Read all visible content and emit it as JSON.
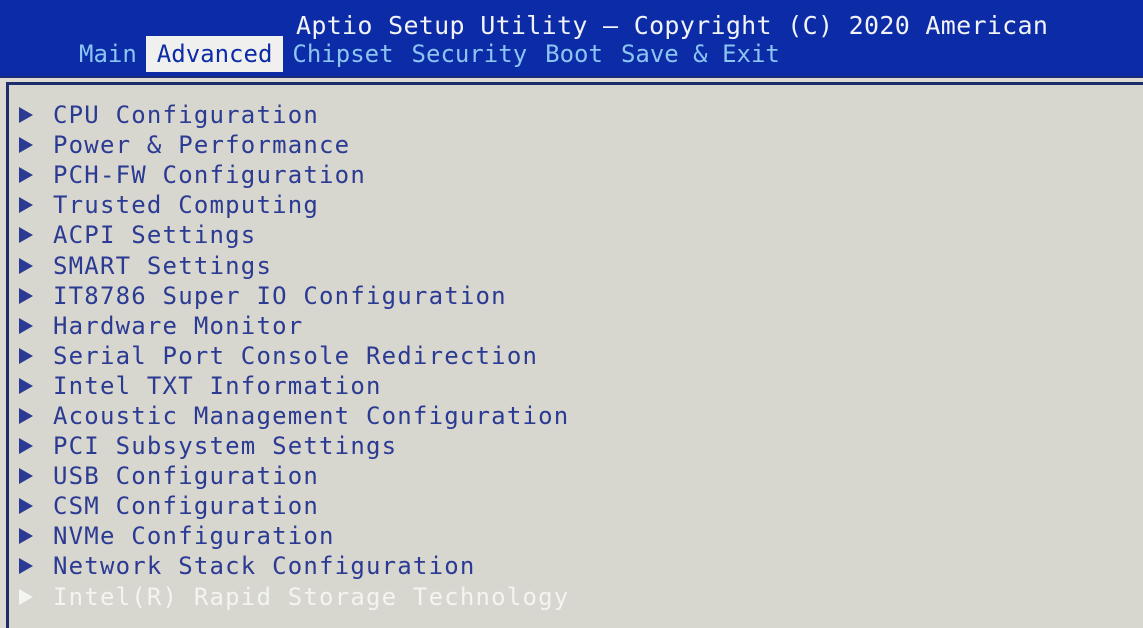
{
  "header": {
    "title": "Aptio Setup Utility – Copyright (C) 2020 American"
  },
  "tabs": [
    {
      "label": "Main",
      "active": false
    },
    {
      "label": "Advanced",
      "active": true
    },
    {
      "label": "Chipset",
      "active": false
    },
    {
      "label": "Security",
      "active": false
    },
    {
      "label": "Boot",
      "active": false
    },
    {
      "label": "Save & Exit",
      "active": false
    }
  ],
  "menu": {
    "items": [
      {
        "label": "CPU Configuration"
      },
      {
        "label": "Power & Performance"
      },
      {
        "label": "PCH-FW Configuration"
      },
      {
        "label": "Trusted Computing"
      },
      {
        "label": "ACPI Settings"
      },
      {
        "label": "SMART Settings"
      },
      {
        "label": "IT8786 Super IO Configuration"
      },
      {
        "label": "Hardware Monitor"
      },
      {
        "label": "Serial Port Console Redirection"
      },
      {
        "label": "Intel TXT Information"
      },
      {
        "label": "Acoustic Management Configuration"
      },
      {
        "label": "PCI Subsystem Settings"
      },
      {
        "label": "USB Configuration"
      },
      {
        "label": "CSM Configuration"
      },
      {
        "label": "NVMe Configuration"
      },
      {
        "label": "Network Stack Configuration"
      },
      {
        "label": "Intel(R) Rapid Storage Technology",
        "selected": true
      }
    ],
    "submenu_icon": "right-triangle-icon"
  },
  "colors": {
    "header_bg": "#0c2ba6",
    "title_text": "#f1f3f8",
    "tab_text": "#8cc4f2",
    "active_tab_bg": "#f0f0ee",
    "panel_bg": "#d7d6cf",
    "item_text": "#2b3a92",
    "selected_text": "#f4f4f1"
  }
}
